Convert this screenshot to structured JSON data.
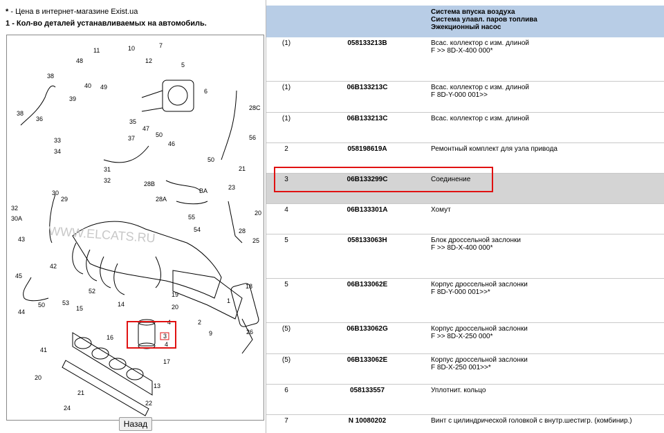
{
  "legend": {
    "star": "*",
    "star_text": "- Цена в интернет-магазине Exist.ua",
    "one": "1",
    "one_text": "- Кол-во деталей устанавливаемых на автомобиль."
  },
  "diagram": {
    "watermark": "WWW.ELCATS.RU",
    "callouts": [
      "48",
      "11",
      "10",
      "7",
      "12",
      "5",
      "38",
      "39",
      "40",
      "49",
      "6",
      "38",
      "36",
      "35",
      "28C",
      "33",
      "34",
      "37",
      "47",
      "50",
      "46",
      "56",
      "31",
      "50",
      "21",
      "32",
      "30",
      "28B",
      "BA",
      "23",
      "29",
      "28A",
      "20",
      "32",
      "30A",
      "55",
      "54",
      "28",
      "43",
      "25",
      "42",
      "45",
      "52",
      "19",
      "18",
      "53",
      "15",
      "14",
      "20",
      "44",
      "50",
      "2",
      "1",
      "9",
      "26",
      "41",
      "16",
      "17",
      "4",
      "3",
      "4",
      "20",
      "21",
      "24",
      "13",
      "22"
    ],
    "back_label": "Назад"
  },
  "table": {
    "header": [
      "Система впуска воздуха",
      "Система улавл. паров топлива",
      "Эжекционный насос"
    ],
    "rows": [
      {
        "qty": "(1)",
        "number": "058133213B",
        "desc": [
          "Всас. коллектор с изм. длиной",
          "F >> 8D-X-400 000*"
        ]
      },
      {
        "qty": "(1)",
        "number": "06B133213C",
        "desc": [
          "Всас. коллектор с изм. длиной",
          "F 8D-Y-000 001>>"
        ]
      },
      {
        "qty": "(1)",
        "number": "06B133213C",
        "desc": [
          "Всас. коллектор с изм. длиной"
        ]
      },
      {
        "qty": "2",
        "number": "058198619A",
        "desc": [
          "Ремонтный комплект для узла привода"
        ]
      },
      {
        "qty": "3",
        "number": "06B133299C",
        "desc": [
          "Соединение"
        ]
      },
      {
        "qty": "4",
        "number": "06B133301A",
        "desc": [
          "Хомут"
        ]
      },
      {
        "qty": "5",
        "number": "058133063H",
        "desc": [
          "Блок дроссельной заслонки",
          "F >> 8D-X-400 000*"
        ]
      },
      {
        "qty": "5",
        "number": "06B133062E",
        "desc": [
          "Корпус дроссельной заслонки",
          "F 8D-Y-000 001>>*"
        ]
      },
      {
        "qty": "(5)",
        "number": "06B133062G",
        "desc": [
          "Корпус дроссельной заслонки",
          "F >> 8D-X-250 000*"
        ]
      },
      {
        "qty": "(5)",
        "number": "06B133062E",
        "desc": [
          "Корпус дроссельной заслонки",
          "F 8D-X-250 001>>*"
        ]
      },
      {
        "qty": "6",
        "number": "058133557",
        "desc": [
          "Уплотнит. кольцо"
        ]
      },
      {
        "qty": "7",
        "number": "N 10080202",
        "desc": [
          "Винт с цилиндрической головкой с внутр.шестигр. (комбинир.)"
        ]
      }
    ]
  },
  "colors": {
    "header_bg": "#b8cde6",
    "highlight_bg": "#d4d4d4",
    "annotation_red": "#e01010"
  }
}
